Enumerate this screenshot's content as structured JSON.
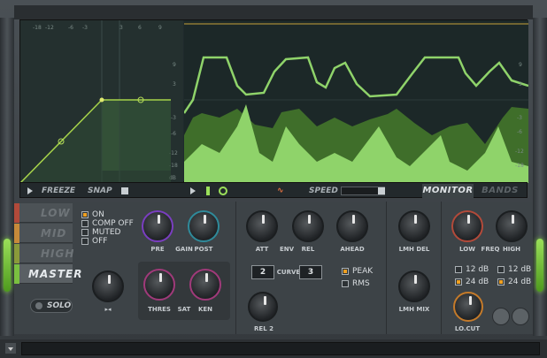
{
  "curve_graph": {
    "top_scale": [
      "-18",
      "-12",
      "-6",
      "-3",
      "3",
      "6",
      "9"
    ],
    "side_scale": [
      "9",
      "6",
      "3",
      "-3",
      "-6",
      "-12",
      "-18"
    ],
    "corner": "dB"
  },
  "wave_graph": {
    "right_scale": [
      "9",
      "6",
      "3",
      "-3",
      "-6",
      "-12",
      "-18"
    ]
  },
  "toolbar": {
    "freeze_label": "FREEZE",
    "snap_label": "SNAP",
    "speed_label": "SPEED",
    "monitor_tab": "MONITOR",
    "bands_tab": "BANDS"
  },
  "bands": [
    {
      "label": "LOW",
      "color": "#b24a3a"
    },
    {
      "label": "MID",
      "color": "#c78a3a"
    },
    {
      "label": "HIGH",
      "color": "#8a9a3a"
    },
    {
      "label": "MASTER",
      "color": "#7ac040"
    }
  ],
  "options": [
    "ON",
    "COMP OFF",
    "MUTED",
    "OFF"
  ],
  "solo_label": "SOLO",
  "knobs": {
    "pre": "PRE",
    "gain": "GAIN",
    "post": "POST",
    "thres": "THRES",
    "sat": "SAT",
    "knee": "KEN",
    "att": "ATT",
    "env": "ENV",
    "rel": "REL",
    "ahead": "AHEAD",
    "rel2": "REL 2",
    "lmh_del": "LMH DEL",
    "lmh_mix": "LMH MIX",
    "low": "LOW",
    "freq": "FREQ",
    "high": "HIGH",
    "lo_cut": "LO.CUT"
  },
  "curve": {
    "label": "CURVE",
    "left_value": "2",
    "right_value": "3"
  },
  "detect": {
    "peak": "PEAK",
    "rms": "RMS"
  },
  "slopes": {
    "low_12": "12 dB",
    "low_24": "24 dB",
    "high_12": "12 dB",
    "high_24": "24 dB"
  },
  "colors": {
    "accent_green": "#7ac040",
    "wave_dark": "#4f8a2c",
    "wave_light": "#9be07a"
  }
}
